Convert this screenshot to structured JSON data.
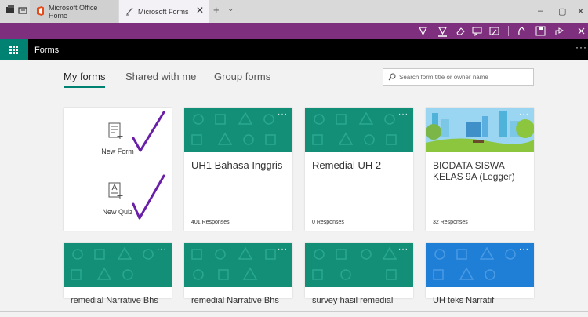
{
  "browser": {
    "tabs": [
      {
        "label": "Microsoft Office Home"
      },
      {
        "label": "Microsoft Forms"
      }
    ],
    "close_glyph": "✕",
    "new_tab_glyph": "+",
    "chevron_glyph": "⌄",
    "window_controls": {
      "minimize": "–",
      "maximize": "▢",
      "close": "✕"
    },
    "accent": "#7e2f7e"
  },
  "app": {
    "name": "Forms",
    "more_glyph": "···",
    "brand_color": "#008272"
  },
  "nav": {
    "tabs": [
      {
        "label": "My forms",
        "selected": true
      },
      {
        "label": "Shared with me",
        "selected": false
      },
      {
        "label": "Group forms",
        "selected": false
      }
    ]
  },
  "search": {
    "placeholder": "Search form title or owner name",
    "value": ""
  },
  "new_items": [
    {
      "label": "New Form",
      "icon": "form-icon"
    },
    {
      "label": "New Quiz",
      "icon": "quiz-icon"
    }
  ],
  "forms": [
    {
      "title": "UH1 Bahasa Inggris",
      "responses": "401 Responses",
      "theme": "#138f78"
    },
    {
      "title": "Remedial UH 2",
      "responses": "0 Responses",
      "theme": "#138f78"
    },
    {
      "title": "BIODATA SISWA KELAS 9A (Legger)",
      "responses": "32 Responses",
      "theme": "image-city-park"
    },
    {
      "title": "remedial Narrative Bhs",
      "responses": "",
      "theme": "#138f78"
    },
    {
      "title": "remedial Narrative Bhs",
      "responses": "",
      "theme": "#138f78"
    },
    {
      "title": "survey hasil remedial",
      "responses": "",
      "theme": "#138f78"
    },
    {
      "title": "UH teks Narratif",
      "responses": "",
      "theme": "#1f7fd6"
    }
  ],
  "card_more_glyph": "···"
}
